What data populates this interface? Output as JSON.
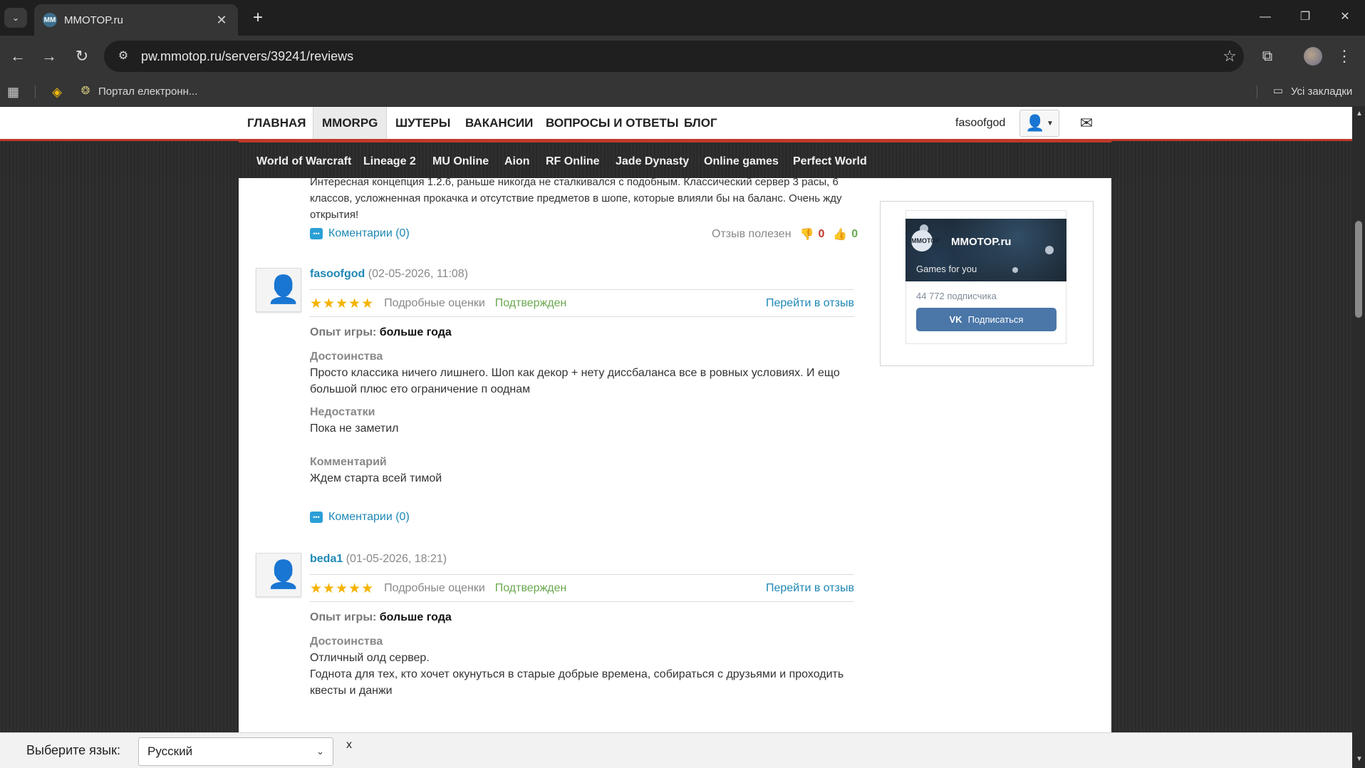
{
  "browser": {
    "tab_title": "MMOTOP.ru",
    "favicon": "MM",
    "url": "pw.mmotop.ru/servers/39241/reviews",
    "bookmark_label": "Портал електронн...",
    "all_bookmarks": "Усі закладки"
  },
  "topnav": {
    "items": [
      "ГЛАВНАЯ",
      "MMORPG",
      "ШУТЕРЫ",
      "ВАКАНСИИ",
      "ВОПРОСЫ И ОТВЕТЫ",
      "БЛОГ"
    ],
    "active": "MMORPG",
    "username": "fasoofgod"
  },
  "gamebar": {
    "items": [
      "World of Warcraft",
      "Lineage 2",
      "MU Online",
      "Aion",
      "RF Online",
      "Jade Dynasty",
      "Online games",
      "Perfect World"
    ]
  },
  "partial_review": {
    "text": "Интересная концепция 1.2.6, раньше никогда не сталкивался с подобным. Классический сервер 3 расы, 6 классов, усложненная прокачка и отсутствие предметов в шопе, которые влияли бы на баланс. Очень жду открытия!",
    "comments": "Коментарии (0)",
    "helpful_label": "Отзыв полезен",
    "helpful_neg": "0",
    "helpful_pos": "0"
  },
  "labels": {
    "detailed": "Подробные оценки",
    "confirmed": "Подтвержден",
    "goto": "Перейти в отзыв",
    "experience": "Опыт игры:",
    "pros": "Достоинства",
    "cons": "Недостатки",
    "comment": "Комментарий",
    "comments_link": "Коментарии (0)",
    "stars": "★★★★★"
  },
  "reviews": [
    {
      "author": "fasoofgod",
      "date": "(02-05-2026, 11:08)",
      "experience": "больше года",
      "pros": "Просто классика ничего лишнего. Шоп как декор + нету диссбаланса все в ровных условиях. И ещо большой плюс ето ограничение п ооднам",
      "cons": "Пока не заметил",
      "comment": "Ждем старта всей тимой"
    },
    {
      "author": "beda1",
      "date": "(01-05-2026, 18:21)",
      "experience": "больше года",
      "pros": "Отличный олд сервер.\nГоднота для тех, кто хочет окунуться в старые добрые времена, собираться с друзьями и проходить квесты и данжи"
    }
  ],
  "vk_widget": {
    "name": "MMOTOP.ru",
    "subtitle": "Games for you",
    "subscribers": "44 772 подписчика",
    "button": "Подписаться",
    "logo_text": "MMOTOP"
  },
  "language_bar": {
    "label": "Выберите язык:",
    "selected": "Русский",
    "close": "x"
  }
}
